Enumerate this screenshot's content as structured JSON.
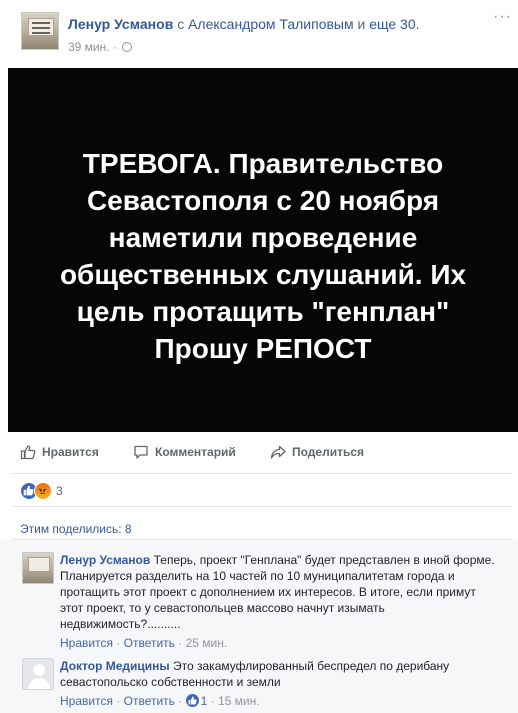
{
  "post": {
    "author": "Ленур Усманов",
    "with_word": "с",
    "tagged": "Александром Талиповым",
    "and_word": "и",
    "others": "еще 30.",
    "time": "39 мин. ·",
    "image_text": [
      "ТРЕВОГА. Правительство",
      "Севастополя с 20 ноября",
      "наметили проведение",
      "общественных слушаний. Их",
      "цель протащить \"генплан\"",
      "Прошу РЕПОСТ"
    ]
  },
  "actions": {
    "like": "Нравится",
    "comment": "Комментарий",
    "share": "Поделиться"
  },
  "reactions": {
    "count": "3",
    "types": [
      "like-icon",
      "angry-icon"
    ],
    "colors": {
      "like": "#4267b2",
      "angry": "#f0920f"
    }
  },
  "shares": "Этим поделились: 8",
  "comments": [
    {
      "author": "Ленур Усманов",
      "text": "Теперь, проект \"Генплана\" будет представлен в иной форме. Планируется разделить на 10 частей по 10 муниципалитетам города и протащить этот проект с дополнением их интересов. В итоге, если примут этот проект, то у севастопольцев массово начнут изымать недвижимость?..........",
      "like_label": "Нравится",
      "reply_label": "Ответить",
      "time": "25 мин."
    },
    {
      "author": "Доктор Медицины",
      "text": "Это закамуфлированный беспредел по дерибану севастопольско собственности и земли",
      "like_label": "Нравится",
      "reply_label": "Ответить",
      "likes": "1",
      "time": "15 мин."
    }
  ],
  "colors": {
    "link": "#365899",
    "muted": "#90949c",
    "image_bg": "#060606"
  }
}
